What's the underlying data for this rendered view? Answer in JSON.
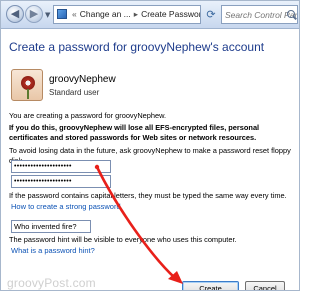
{
  "navbar": {
    "back_icon": "back-arrow-icon",
    "forward_icon": "forward-arrow-icon",
    "crumbs": [
      "Change an ...",
      "Create Password"
    ],
    "crumb_separator": "▸",
    "refresh_icon": "refresh-icon",
    "search_placeholder": "Search Control Panel"
  },
  "main": {
    "title": "Create a password for groovyNephew's account",
    "account": {
      "name": "groovyNephew",
      "type": "Standard user"
    },
    "creating_text": "You are creating a password for groovyNephew.",
    "warning_text": "If you do this, groovyNephew will lose all EFS-encrypted files, personal certificates and stored passwords for Web sites or network resources.",
    "floppy_text": "To avoid losing data in the future, ask groovyNephew to make a password reset floppy disk.",
    "password_value": "•••••••••••••••••••••",
    "confirm_value": "•••••••••••••••••••••",
    "caps_text": "If the password contains capital letters, they must be typed the same way every time.",
    "strong_link": "How to create a strong password",
    "hint_value": "Who invented fire?",
    "hint_visible_text": "The password hint will be visible to everyone who uses this computer.",
    "hint_link": "What is a password hint?",
    "create_button": "Create password",
    "cancel_button": "Cancel"
  },
  "watermark": "groovyPost.com",
  "colors": {
    "title_blue": "#1e3c8c",
    "link_blue": "#0d53b5",
    "annotation_red": "#e8201a"
  }
}
